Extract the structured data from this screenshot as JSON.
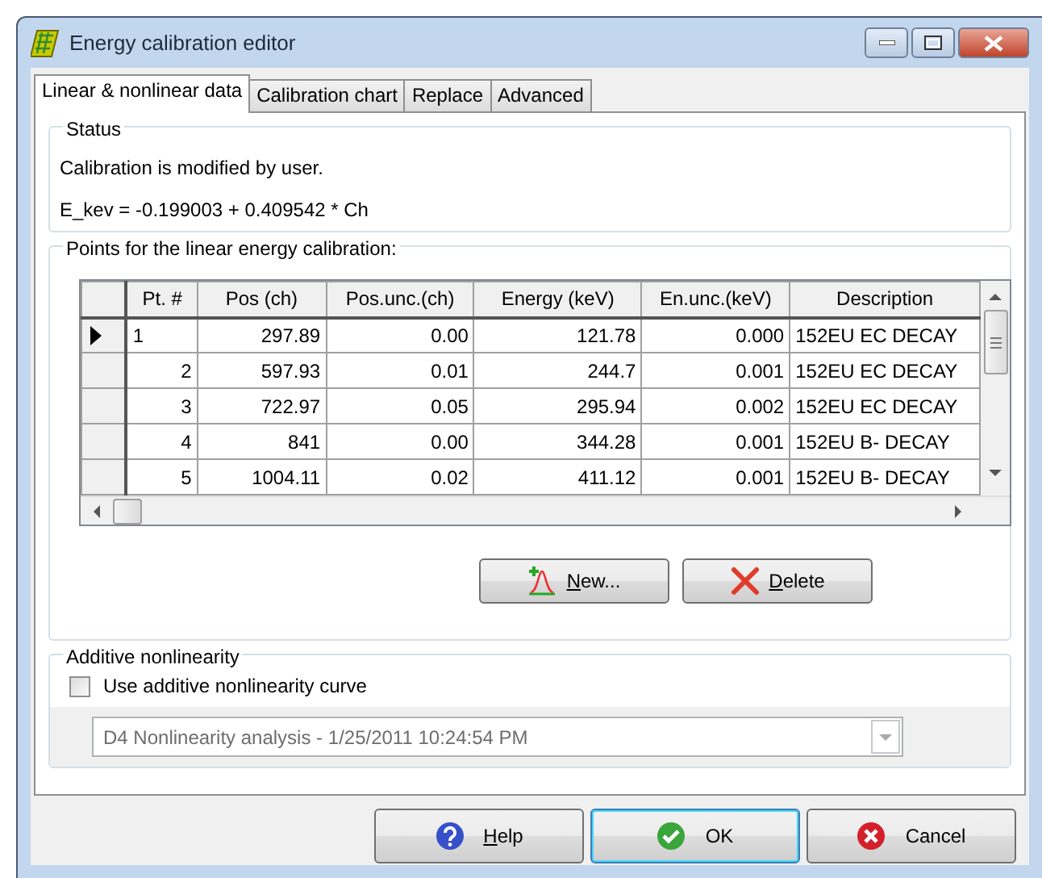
{
  "window": {
    "title": "Energy calibration editor"
  },
  "tabs": [
    {
      "label": "Linear & nonlinear data",
      "selected": true
    },
    {
      "label": "Calibration chart",
      "selected": false
    },
    {
      "label": "Replace",
      "selected": false
    },
    {
      "label": "Advanced",
      "selected": false
    }
  ],
  "status": {
    "title": "Status",
    "message": "Calibration is modified by user.",
    "formula": "E_kev = -0.199003 + 0.409542 * Ch"
  },
  "points": {
    "title": "Points for the linear energy calibration:",
    "table": {
      "columns": [
        "Pt. #",
        "Pos (ch)",
        "Pos.unc.(ch)",
        "Energy (keV)",
        "En.unc.(keV)",
        "Description"
      ],
      "rows": [
        {
          "selected": true,
          "cells": [
            "1",
            "297.89",
            "0.00",
            "121.78",
            "0.000",
            "152EU EC DECAY"
          ]
        },
        {
          "selected": false,
          "cells": [
            "2",
            "597.93",
            "0.01",
            "244.7",
            "0.001",
            "152EU EC DECAY"
          ]
        },
        {
          "selected": false,
          "cells": [
            "3",
            "722.97",
            "0.05",
            "295.94",
            "0.002",
            "152EU EC DECAY"
          ]
        },
        {
          "selected": false,
          "cells": [
            "4",
            "841",
            "0.00",
            "344.28",
            "0.001",
            "152EU B- DECAY"
          ]
        },
        {
          "selected": false,
          "cells": [
            "5",
            "1004.11",
            "0.02",
            "411.12",
            "0.001",
            "152EU B- DECAY"
          ]
        }
      ]
    },
    "buttons": [
      {
        "kind": "new",
        "label": "New..."
      },
      {
        "kind": "delete",
        "label": "Delete"
      }
    ]
  },
  "nonlinearity": {
    "title": "Additive nonlinearity",
    "checkbox": {
      "label": "Use additive nonlinearity curve",
      "checked": false
    },
    "combo": {
      "value": "D4 Nonlinearity analysis - 1/25/2011 10:24:54 PM",
      "disabled": true
    }
  },
  "footer_buttons": [
    {
      "kind": "help",
      "label": "Help",
      "default": false
    },
    {
      "kind": "ok",
      "label": "OK",
      "default": true
    },
    {
      "kind": "cancel",
      "label": "Cancel",
      "default": false
    }
  ]
}
